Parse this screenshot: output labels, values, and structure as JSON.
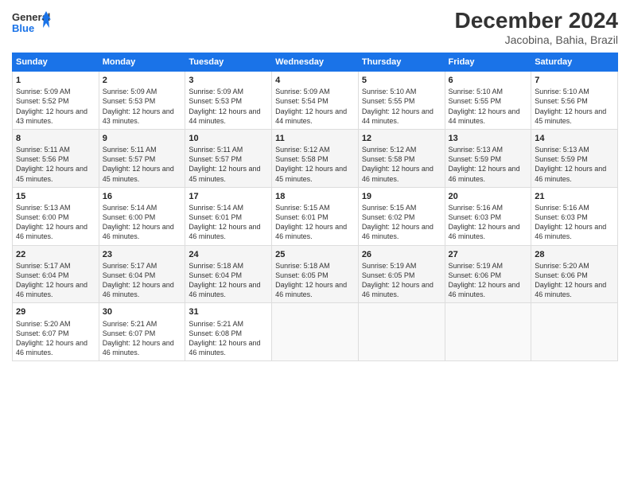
{
  "header": {
    "logo_line1": "General",
    "logo_line2": "Blue",
    "main_title": "December 2024",
    "subtitle": "Jacobina, Bahia, Brazil"
  },
  "calendar": {
    "days_of_week": [
      "Sunday",
      "Monday",
      "Tuesday",
      "Wednesday",
      "Thursday",
      "Friday",
      "Saturday"
    ],
    "weeks": [
      [
        {
          "day": "1",
          "sunrise": "5:09 AM",
          "sunset": "5:52 PM",
          "daylight": "12 hours and 43 minutes."
        },
        {
          "day": "2",
          "sunrise": "5:09 AM",
          "sunset": "5:53 PM",
          "daylight": "12 hours and 43 minutes."
        },
        {
          "day": "3",
          "sunrise": "5:09 AM",
          "sunset": "5:53 PM",
          "daylight": "12 hours and 44 minutes."
        },
        {
          "day": "4",
          "sunrise": "5:09 AM",
          "sunset": "5:54 PM",
          "daylight": "12 hours and 44 minutes."
        },
        {
          "day": "5",
          "sunrise": "5:10 AM",
          "sunset": "5:55 PM",
          "daylight": "12 hours and 44 minutes."
        },
        {
          "day": "6",
          "sunrise": "5:10 AM",
          "sunset": "5:55 PM",
          "daylight": "12 hours and 44 minutes."
        },
        {
          "day": "7",
          "sunrise": "5:10 AM",
          "sunset": "5:56 PM",
          "daylight": "12 hours and 45 minutes."
        }
      ],
      [
        {
          "day": "8",
          "sunrise": "5:11 AM",
          "sunset": "5:56 PM",
          "daylight": "12 hours and 45 minutes."
        },
        {
          "day": "9",
          "sunrise": "5:11 AM",
          "sunset": "5:57 PM",
          "daylight": "12 hours and 45 minutes."
        },
        {
          "day": "10",
          "sunrise": "5:11 AM",
          "sunset": "5:57 PM",
          "daylight": "12 hours and 45 minutes."
        },
        {
          "day": "11",
          "sunrise": "5:12 AM",
          "sunset": "5:58 PM",
          "daylight": "12 hours and 45 minutes."
        },
        {
          "day": "12",
          "sunrise": "5:12 AM",
          "sunset": "5:58 PM",
          "daylight": "12 hours and 46 minutes."
        },
        {
          "day": "13",
          "sunrise": "5:13 AM",
          "sunset": "5:59 PM",
          "daylight": "12 hours and 46 minutes."
        },
        {
          "day": "14",
          "sunrise": "5:13 AM",
          "sunset": "5:59 PM",
          "daylight": "12 hours and 46 minutes."
        }
      ],
      [
        {
          "day": "15",
          "sunrise": "5:13 AM",
          "sunset": "6:00 PM",
          "daylight": "12 hours and 46 minutes."
        },
        {
          "day": "16",
          "sunrise": "5:14 AM",
          "sunset": "6:00 PM",
          "daylight": "12 hours and 46 minutes."
        },
        {
          "day": "17",
          "sunrise": "5:14 AM",
          "sunset": "6:01 PM",
          "daylight": "12 hours and 46 minutes."
        },
        {
          "day": "18",
          "sunrise": "5:15 AM",
          "sunset": "6:01 PM",
          "daylight": "12 hours and 46 minutes."
        },
        {
          "day": "19",
          "sunrise": "5:15 AM",
          "sunset": "6:02 PM",
          "daylight": "12 hours and 46 minutes."
        },
        {
          "day": "20",
          "sunrise": "5:16 AM",
          "sunset": "6:03 PM",
          "daylight": "12 hours and 46 minutes."
        },
        {
          "day": "21",
          "sunrise": "5:16 AM",
          "sunset": "6:03 PM",
          "daylight": "12 hours and 46 minutes."
        }
      ],
      [
        {
          "day": "22",
          "sunrise": "5:17 AM",
          "sunset": "6:04 PM",
          "daylight": "12 hours and 46 minutes."
        },
        {
          "day": "23",
          "sunrise": "5:17 AM",
          "sunset": "6:04 PM",
          "daylight": "12 hours and 46 minutes."
        },
        {
          "day": "24",
          "sunrise": "5:18 AM",
          "sunset": "6:04 PM",
          "daylight": "12 hours and 46 minutes."
        },
        {
          "day": "25",
          "sunrise": "5:18 AM",
          "sunset": "6:05 PM",
          "daylight": "12 hours and 46 minutes."
        },
        {
          "day": "26",
          "sunrise": "5:19 AM",
          "sunset": "6:05 PM",
          "daylight": "12 hours and 46 minutes."
        },
        {
          "day": "27",
          "sunrise": "5:19 AM",
          "sunset": "6:06 PM",
          "daylight": "12 hours and 46 minutes."
        },
        {
          "day": "28",
          "sunrise": "5:20 AM",
          "sunset": "6:06 PM",
          "daylight": "12 hours and 46 minutes."
        }
      ],
      [
        {
          "day": "29",
          "sunrise": "5:20 AM",
          "sunset": "6:07 PM",
          "daylight": "12 hours and 46 minutes."
        },
        {
          "day": "30",
          "sunrise": "5:21 AM",
          "sunset": "6:07 PM",
          "daylight": "12 hours and 46 minutes."
        },
        {
          "day": "31",
          "sunrise": "5:21 AM",
          "sunset": "6:08 PM",
          "daylight": "12 hours and 46 minutes."
        },
        null,
        null,
        null,
        null
      ]
    ]
  }
}
